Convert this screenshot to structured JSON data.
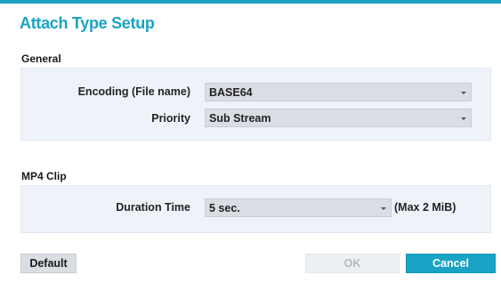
{
  "dialog": {
    "title": "Attach Type Setup"
  },
  "general": {
    "label": "General",
    "encoding": {
      "label": "Encoding (File name)",
      "value": "BASE64"
    },
    "priority": {
      "label": "Priority",
      "value": "Sub Stream"
    }
  },
  "mp4_clip": {
    "label": "MP4 Clip",
    "duration": {
      "label": "Duration Time",
      "value": "5 sec.",
      "hint": "(Max 2 MiB)"
    }
  },
  "buttons": {
    "default": "Default",
    "ok": "OK",
    "cancel": "Cancel"
  },
  "colors": {
    "accent": "#1aa3c4",
    "panel": "#eef3fa",
    "disabled_text": "#b3b8bf"
  },
  "icons": {
    "dropdown": "chevron-down-icon"
  }
}
